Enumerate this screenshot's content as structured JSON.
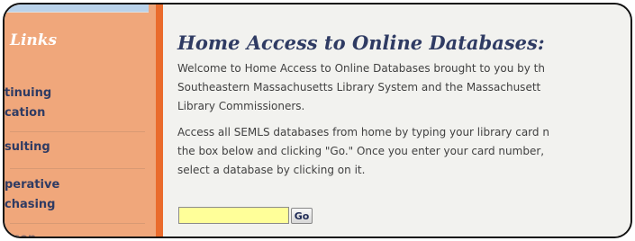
{
  "sidebar": {
    "title": "Links",
    "items": [
      {
        "lines": [
          "tinuing",
          "cation"
        ]
      },
      {
        "lines": [
          "sulting"
        ]
      },
      {
        "lines": [
          "perative",
          "chasing"
        ]
      },
      {
        "lines": [
          "ucon"
        ]
      }
    ]
  },
  "main": {
    "title": "Home Access to Online Databases:",
    "paragraph1": [
      "Welcome to Home Access to Online Databases brought to you by th",
      "Southeastern Massachusetts Library System and the Massachusett",
      "Library Commissioners."
    ],
    "paragraph2": [
      "Access all SEMLS databases from home by typing your library card n",
      "the box below and clicking \"Go.\" Once you enter your card number,",
      "select a database by clicking on it."
    ],
    "card_input_value": "",
    "go_label": "Go"
  },
  "colors": {
    "sidebar": "#f0a77b",
    "accent": "#ea6b2c",
    "title": "#2f3b63",
    "input": "#ffff99"
  }
}
